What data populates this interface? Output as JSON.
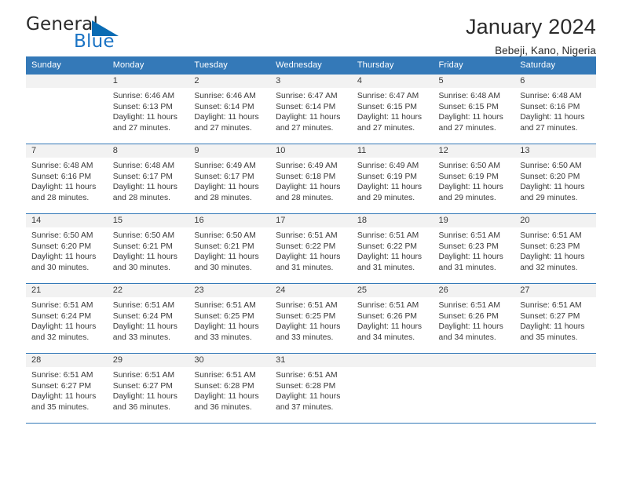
{
  "brand": {
    "name_part1": "General",
    "name_part2": "Blue",
    "triangle_color": "#0a6cb4",
    "blue_color": "#1a73c4"
  },
  "header": {
    "title": "January 2024",
    "subtitle": "Bebeji, Kano, Nigeria"
  },
  "theme": {
    "header_bg": "#3479b8",
    "header_text": "#ffffff",
    "daynum_bg": "#f2f2f2",
    "grid_line": "#3479b8"
  },
  "weekdays": [
    "Sunday",
    "Monday",
    "Tuesday",
    "Wednesday",
    "Thursday",
    "Friday",
    "Saturday"
  ],
  "labels": {
    "sunrise_prefix": "Sunrise: ",
    "sunset_prefix": "Sunset: ",
    "daylight_prefix": "Daylight: "
  },
  "weeks": [
    [
      {
        "empty": true
      },
      {
        "day": "1",
        "sunrise": "Sunrise: 6:46 AM",
        "sunset": "Sunset: 6:13 PM",
        "daylight_line1": "Daylight: 11 hours",
        "daylight_line2": "and 27 minutes."
      },
      {
        "day": "2",
        "sunrise": "Sunrise: 6:46 AM",
        "sunset": "Sunset: 6:14 PM",
        "daylight_line1": "Daylight: 11 hours",
        "daylight_line2": "and 27 minutes."
      },
      {
        "day": "3",
        "sunrise": "Sunrise: 6:47 AM",
        "sunset": "Sunset: 6:14 PM",
        "daylight_line1": "Daylight: 11 hours",
        "daylight_line2": "and 27 minutes."
      },
      {
        "day": "4",
        "sunrise": "Sunrise: 6:47 AM",
        "sunset": "Sunset: 6:15 PM",
        "daylight_line1": "Daylight: 11 hours",
        "daylight_line2": "and 27 minutes."
      },
      {
        "day": "5",
        "sunrise": "Sunrise: 6:48 AM",
        "sunset": "Sunset: 6:15 PM",
        "daylight_line1": "Daylight: 11 hours",
        "daylight_line2": "and 27 minutes."
      },
      {
        "day": "6",
        "sunrise": "Sunrise: 6:48 AM",
        "sunset": "Sunset: 6:16 PM",
        "daylight_line1": "Daylight: 11 hours",
        "daylight_line2": "and 27 minutes."
      }
    ],
    [
      {
        "day": "7",
        "sunrise": "Sunrise: 6:48 AM",
        "sunset": "Sunset: 6:16 PM",
        "daylight_line1": "Daylight: 11 hours",
        "daylight_line2": "and 28 minutes."
      },
      {
        "day": "8",
        "sunrise": "Sunrise: 6:48 AM",
        "sunset": "Sunset: 6:17 PM",
        "daylight_line1": "Daylight: 11 hours",
        "daylight_line2": "and 28 minutes."
      },
      {
        "day": "9",
        "sunrise": "Sunrise: 6:49 AM",
        "sunset": "Sunset: 6:17 PM",
        "daylight_line1": "Daylight: 11 hours",
        "daylight_line2": "and 28 minutes."
      },
      {
        "day": "10",
        "sunrise": "Sunrise: 6:49 AM",
        "sunset": "Sunset: 6:18 PM",
        "daylight_line1": "Daylight: 11 hours",
        "daylight_line2": "and 28 minutes."
      },
      {
        "day": "11",
        "sunrise": "Sunrise: 6:49 AM",
        "sunset": "Sunset: 6:19 PM",
        "daylight_line1": "Daylight: 11 hours",
        "daylight_line2": "and 29 minutes."
      },
      {
        "day": "12",
        "sunrise": "Sunrise: 6:50 AM",
        "sunset": "Sunset: 6:19 PM",
        "daylight_line1": "Daylight: 11 hours",
        "daylight_line2": "and 29 minutes."
      },
      {
        "day": "13",
        "sunrise": "Sunrise: 6:50 AM",
        "sunset": "Sunset: 6:20 PM",
        "daylight_line1": "Daylight: 11 hours",
        "daylight_line2": "and 29 minutes."
      }
    ],
    [
      {
        "day": "14",
        "sunrise": "Sunrise: 6:50 AM",
        "sunset": "Sunset: 6:20 PM",
        "daylight_line1": "Daylight: 11 hours",
        "daylight_line2": "and 30 minutes."
      },
      {
        "day": "15",
        "sunrise": "Sunrise: 6:50 AM",
        "sunset": "Sunset: 6:21 PM",
        "daylight_line1": "Daylight: 11 hours",
        "daylight_line2": "and 30 minutes."
      },
      {
        "day": "16",
        "sunrise": "Sunrise: 6:50 AM",
        "sunset": "Sunset: 6:21 PM",
        "daylight_line1": "Daylight: 11 hours",
        "daylight_line2": "and 30 minutes."
      },
      {
        "day": "17",
        "sunrise": "Sunrise: 6:51 AM",
        "sunset": "Sunset: 6:22 PM",
        "daylight_line1": "Daylight: 11 hours",
        "daylight_line2": "and 31 minutes."
      },
      {
        "day": "18",
        "sunrise": "Sunrise: 6:51 AM",
        "sunset": "Sunset: 6:22 PM",
        "daylight_line1": "Daylight: 11 hours",
        "daylight_line2": "and 31 minutes."
      },
      {
        "day": "19",
        "sunrise": "Sunrise: 6:51 AM",
        "sunset": "Sunset: 6:23 PM",
        "daylight_line1": "Daylight: 11 hours",
        "daylight_line2": "and 31 minutes."
      },
      {
        "day": "20",
        "sunrise": "Sunrise: 6:51 AM",
        "sunset": "Sunset: 6:23 PM",
        "daylight_line1": "Daylight: 11 hours",
        "daylight_line2": "and 32 minutes."
      }
    ],
    [
      {
        "day": "21",
        "sunrise": "Sunrise: 6:51 AM",
        "sunset": "Sunset: 6:24 PM",
        "daylight_line1": "Daylight: 11 hours",
        "daylight_line2": "and 32 minutes."
      },
      {
        "day": "22",
        "sunrise": "Sunrise: 6:51 AM",
        "sunset": "Sunset: 6:24 PM",
        "daylight_line1": "Daylight: 11 hours",
        "daylight_line2": "and 33 minutes."
      },
      {
        "day": "23",
        "sunrise": "Sunrise: 6:51 AM",
        "sunset": "Sunset: 6:25 PM",
        "daylight_line1": "Daylight: 11 hours",
        "daylight_line2": "and 33 minutes."
      },
      {
        "day": "24",
        "sunrise": "Sunrise: 6:51 AM",
        "sunset": "Sunset: 6:25 PM",
        "daylight_line1": "Daylight: 11 hours",
        "daylight_line2": "and 33 minutes."
      },
      {
        "day": "25",
        "sunrise": "Sunrise: 6:51 AM",
        "sunset": "Sunset: 6:26 PM",
        "daylight_line1": "Daylight: 11 hours",
        "daylight_line2": "and 34 minutes."
      },
      {
        "day": "26",
        "sunrise": "Sunrise: 6:51 AM",
        "sunset": "Sunset: 6:26 PM",
        "daylight_line1": "Daylight: 11 hours",
        "daylight_line2": "and 34 minutes."
      },
      {
        "day": "27",
        "sunrise": "Sunrise: 6:51 AM",
        "sunset": "Sunset: 6:27 PM",
        "daylight_line1": "Daylight: 11 hours",
        "daylight_line2": "and 35 minutes."
      }
    ],
    [
      {
        "day": "28",
        "sunrise": "Sunrise: 6:51 AM",
        "sunset": "Sunset: 6:27 PM",
        "daylight_line1": "Daylight: 11 hours",
        "daylight_line2": "and 35 minutes."
      },
      {
        "day": "29",
        "sunrise": "Sunrise: 6:51 AM",
        "sunset": "Sunset: 6:27 PM",
        "daylight_line1": "Daylight: 11 hours",
        "daylight_line2": "and 36 minutes."
      },
      {
        "day": "30",
        "sunrise": "Sunrise: 6:51 AM",
        "sunset": "Sunset: 6:28 PM",
        "daylight_line1": "Daylight: 11 hours",
        "daylight_line2": "and 36 minutes."
      },
      {
        "day": "31",
        "sunrise": "Sunrise: 6:51 AM",
        "sunset": "Sunset: 6:28 PM",
        "daylight_line1": "Daylight: 11 hours",
        "daylight_line2": "and 37 minutes."
      },
      {
        "empty": true
      },
      {
        "empty": true
      },
      {
        "empty": true
      }
    ]
  ]
}
